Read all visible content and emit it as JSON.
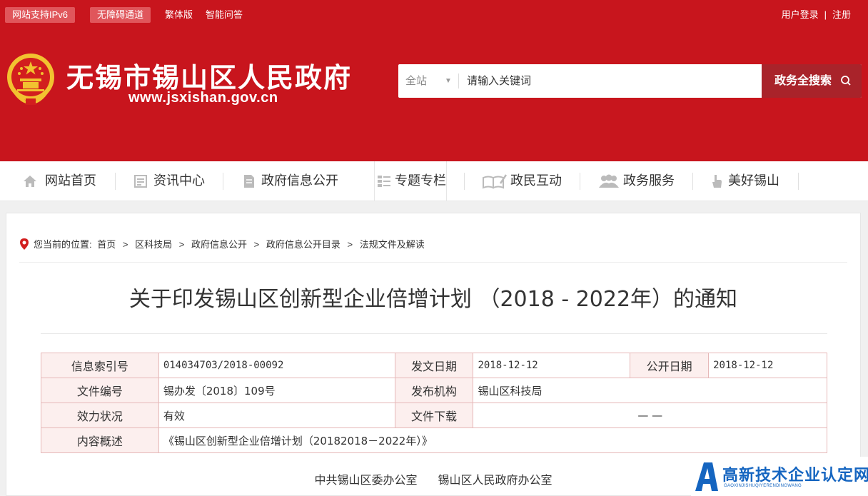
{
  "topbar": {
    "ipv6_label": "网站支持IPv6",
    "accessibility_label": "无障碍通道",
    "traditional_label": "繁体版",
    "qa_label": "智能问答",
    "login_label": "用户登录",
    "separator": "|",
    "register_label": "注册"
  },
  "header": {
    "site_title": "无锡市锡山区人民政府",
    "site_url": "www.jsxishan.gov.cn",
    "search": {
      "scope": "全站",
      "caret": "▼",
      "placeholder": "请输入关键词",
      "button_label": "政务全搜索"
    }
  },
  "nav": {
    "items": [
      {
        "label": "网站首页",
        "icon": "home-icon"
      },
      {
        "label": "资讯中心",
        "icon": "news-icon"
      },
      {
        "label": "政府信息公开",
        "icon": "document-icon"
      },
      {
        "label": "专题专栏",
        "icon": "columns-icon"
      },
      {
        "label": "政民互动",
        "icon": "book-pen-icon"
      },
      {
        "label": "政务服务",
        "icon": "people-icon"
      },
      {
        "label": "美好锡山",
        "icon": "hand-icon"
      }
    ]
  },
  "breadcrumb": {
    "prefix": "您当前的位置:",
    "items": [
      "首页",
      "区科技局",
      "政府信息公开",
      "政府信息公开目录",
      "法规文件及解读"
    ],
    "separator": ">"
  },
  "article": {
    "title": "关于印发锡山区创新型企业倍增计划 （2018 - 2022年）的通知",
    "info": {
      "index_label": "信息索引号",
      "index_value": "014034703/2018-00092",
      "issue_date_label": "发文日期",
      "issue_date_value": "2018-12-12",
      "public_date_label": "公开日期",
      "public_date_value": "2018-12-12",
      "doc_no_label": "文件编号",
      "doc_no_value": "锡办发〔2018〕109号",
      "publisher_label": "发布机构",
      "publisher_value": "锡山区科技局",
      "status_label": "效力状况",
      "status_value": "有效",
      "download_label": "文件下载",
      "download_value": "—  —",
      "summary_label": "内容概述",
      "summary_value": "《锡山区创新型企业倍增计划（20182018－2022年）》"
    },
    "signers": [
      "中共锡山区委办公室",
      "锡山区人民政府办公室"
    ]
  },
  "watermark": {
    "title": "高新技术企业认定网",
    "subtitle": "GAOXINJISHUQIYERENDINGWANG"
  },
  "colors": {
    "header_red": "#c8151d",
    "search_button": "#a9232a",
    "table_label_bg": "#fcefee",
    "watermark_blue": "#1565c0"
  }
}
